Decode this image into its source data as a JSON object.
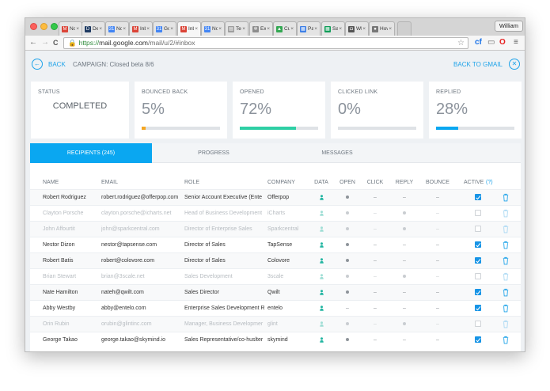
{
  "browser": {
    "tabs": [
      {
        "label": "Nov",
        "fav_char": "M",
        "fav_color": "#db4437",
        "active": false
      },
      {
        "label": "Dev",
        "fav_char": "D",
        "fav_color": "#1f3b63",
        "active": false
      },
      {
        "label": "Nov",
        "fav_char": "31",
        "fav_color": "#4285f4",
        "active": false
      },
      {
        "label": "Inb",
        "fav_char": "M",
        "fav_color": "#db4437",
        "active": false
      },
      {
        "label": "Goo",
        "fav_char": "31",
        "fav_color": "#4285f4",
        "active": false
      },
      {
        "label": "Inb",
        "fav_char": "M",
        "fav_color": "#db4437",
        "active": true
      },
      {
        "label": "Nov",
        "fav_char": "31",
        "fav_color": "#4285f4",
        "active": false
      },
      {
        "label": "Tea",
        "fav_char": "▤",
        "fav_color": "#9e9e9e",
        "active": false
      },
      {
        "label": "Exte",
        "fav_char": "✲",
        "fav_color": "#8d8d8d",
        "active": false
      },
      {
        "label": "Cus",
        "fav_char": "▲",
        "fav_color": "#34a853",
        "active": false
      },
      {
        "label": "Pale",
        "fav_char": "▦",
        "fav_color": "#3d7fe6",
        "active": false
      },
      {
        "label": "Sale",
        "fav_char": "▦",
        "fav_color": "#0f9d58",
        "active": false
      },
      {
        "label": "Wha",
        "fav_char": "◘",
        "fav_color": "#555555",
        "active": false
      },
      {
        "label": "Hov",
        "fav_char": "●",
        "fav_color": "#777777",
        "active": false
      }
    ],
    "tab_close": "×",
    "user_name": "William",
    "url_https": "https://",
    "url_host": "mail.google.com",
    "url_path": "/mail/u/2/#inbox"
  },
  "header": {
    "back_label": "BACK",
    "campaign_label": "CAMPAIGN: Closed beta 8/6",
    "back_to_gmail_label": "BACK TO GMAIL"
  },
  "stats": [
    {
      "label": "STATUS",
      "value": "COMPLETED",
      "has_bar": false
    },
    {
      "label": "BOUNCED BACK",
      "value": "5%",
      "has_bar": true,
      "progress": 0.05,
      "color": "#f5a623"
    },
    {
      "label": "OPENED",
      "value": "72%",
      "has_bar": true,
      "progress": 0.72,
      "color": "#2ecfa5"
    },
    {
      "label": "CLICKED LINK",
      "value": "0%",
      "has_bar": true,
      "progress": 0.0,
      "color": "#0aa7f1"
    },
    {
      "label": "REPLIED",
      "value": "28%",
      "has_bar": true,
      "progress": 0.28,
      "color": "#0aa7f1"
    }
  ],
  "panel_tabs": [
    {
      "label": "RECIPIENTS (245)",
      "active": true
    },
    {
      "label": "PROGRESS",
      "active": false
    },
    {
      "label": "MESSAGES",
      "active": false
    }
  ],
  "table": {
    "columns": {
      "name": "NAME",
      "email": "EMAIL",
      "role": "ROLE",
      "company": "COMPANY",
      "data": "DATA",
      "open": "OPEN",
      "click": "CLICK",
      "reply": "REPLY",
      "bounce": "BOUNCE",
      "active": "ACTIVE",
      "active_help": "(?)"
    },
    "dash": "–",
    "rows": [
      {
        "name": "Robert Rodriguez",
        "email": "robert.rodriguez@offerpop.com",
        "role": "Senior Account Executive (Ente",
        "company": "Offerpop",
        "open": true,
        "reply": false,
        "active": true
      },
      {
        "name": "Clayton Porsche",
        "email": "clayton.porsche@icharts.net",
        "role": "Head of Business Development",
        "company": "iCharts",
        "open": true,
        "reply": true,
        "active": false
      },
      {
        "name": "John Affourtit",
        "email": "john@sparkcentral.com",
        "role": "Director of Enterprise Sales",
        "company": "Sparkcentral",
        "open": true,
        "reply": true,
        "active": false
      },
      {
        "name": "Nestor Dizon",
        "email": "nestor@tapsense.com",
        "role": "Director of Sales",
        "company": "TapSense",
        "open": true,
        "reply": false,
        "active": true
      },
      {
        "name": "Robert Batis",
        "email": "robert@colovore.com",
        "role": "Director of Sales",
        "company": "Colovore",
        "open": true,
        "reply": false,
        "active": true
      },
      {
        "name": "Brian Stewart",
        "email": "brian@3scale.net",
        "role": "Sales Development",
        "company": "3scale",
        "open": true,
        "reply": true,
        "active": false
      },
      {
        "name": "Nate Hamilton",
        "email": "nateh@qwilt.com",
        "role": "Sales Director",
        "company": "Qwilt",
        "open": true,
        "reply": false,
        "active": true
      },
      {
        "name": "Abby Westby",
        "email": "abby@entelo.com",
        "role": "Enterprise Sales Development R",
        "company": "entelo",
        "open": false,
        "reply": false,
        "active": true
      },
      {
        "name": "Orin Rubin",
        "email": "orubin@glintinc.com",
        "role": "Manager, Business Developmer",
        "company": "glint",
        "open": true,
        "reply": true,
        "active": false
      },
      {
        "name": "George Takao",
        "email": "george.takao@skymind.io",
        "role": "Sales Representative/co-huslter",
        "company": "skymind",
        "open": true,
        "reply": false,
        "active": true
      }
    ]
  },
  "colors": {
    "accent": "#1ea3e9",
    "tab_active": "#0aa7f1",
    "checkbox": "#1794e6",
    "data_pin": "#22b5a1"
  }
}
